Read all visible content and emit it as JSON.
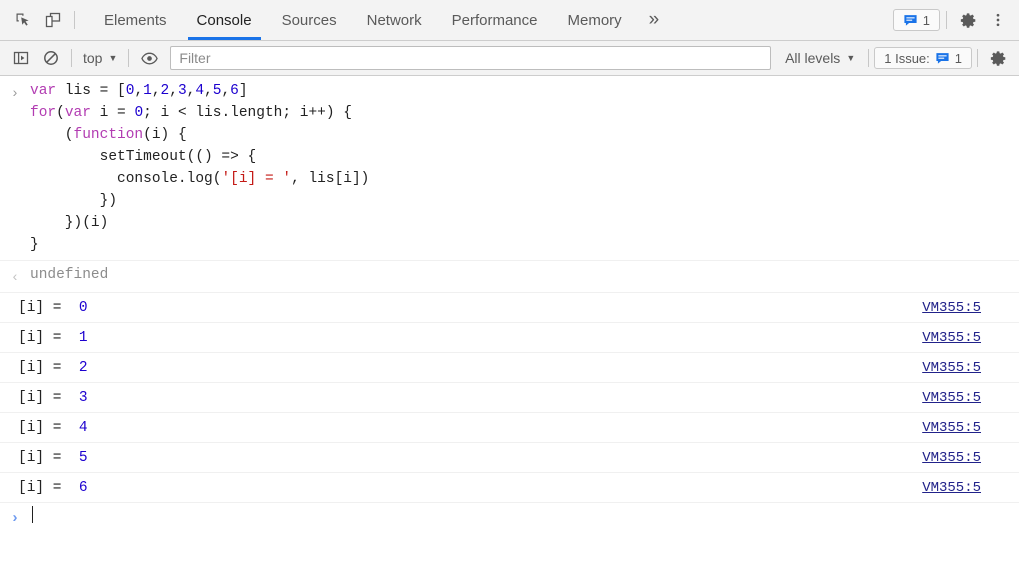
{
  "tabbar": {
    "inspect_icon": "inspect-element-icon",
    "device_icon": "device-toolbar-icon",
    "tabs": [
      {
        "id": "elements",
        "label": "Elements",
        "active": false
      },
      {
        "id": "console",
        "label": "Console",
        "active": true
      },
      {
        "id": "sources",
        "label": "Sources",
        "active": false
      },
      {
        "id": "network",
        "label": "Network",
        "active": false
      },
      {
        "id": "performance",
        "label": "Performance",
        "active": false
      },
      {
        "id": "memory",
        "label": "Memory",
        "active": false
      }
    ],
    "more_tabs_glyph": "»",
    "issues_badge": {
      "icon": "issue-message-icon",
      "count": "1"
    },
    "settings_icon": "gear-icon",
    "more_options_icon": "kebab-menu-icon",
    "accent_color": "#1a73e8"
  },
  "toolbar": {
    "sidebar_icon": "console-sidebar-icon",
    "clear_icon": "clear-console-icon",
    "context_label": "top",
    "eye_icon": "live-expression-icon",
    "filter_placeholder": "Filter",
    "filter_value": "",
    "levels_label": "All levels",
    "issue_chip_label": "1 Issue:",
    "issue_chip_count": "1",
    "settings_icon": "gear-icon",
    "caret_glyph": "▼"
  },
  "console": {
    "input_prompt": "›",
    "input_lines": [
      [
        {
          "t": "var ",
          "c": "kw"
        },
        {
          "t": "lis = [",
          "c": ""
        },
        {
          "t": "0",
          "c": "num"
        },
        {
          "t": ",",
          "c": ""
        },
        {
          "t": "1",
          "c": "num"
        },
        {
          "t": ",",
          "c": ""
        },
        {
          "t": "2",
          "c": "num"
        },
        {
          "t": ",",
          "c": ""
        },
        {
          "t": "3",
          "c": "num"
        },
        {
          "t": ",",
          "c": ""
        },
        {
          "t": "4",
          "c": "num"
        },
        {
          "t": ",",
          "c": ""
        },
        {
          "t": "5",
          "c": "num"
        },
        {
          "t": ",",
          "c": ""
        },
        {
          "t": "6",
          "c": "num"
        },
        {
          "t": "]",
          "c": ""
        }
      ],
      [
        {
          "t": "for",
          "c": "kw"
        },
        {
          "t": "(",
          "c": ""
        },
        {
          "t": "var ",
          "c": "kw"
        },
        {
          "t": "i = ",
          "c": ""
        },
        {
          "t": "0",
          "c": "num"
        },
        {
          "t": "; i < lis.length; i++) {",
          "c": ""
        }
      ],
      [
        {
          "t": "    (",
          "c": ""
        },
        {
          "t": "function",
          "c": "kw"
        },
        {
          "t": "(i) {",
          "c": ""
        }
      ],
      [
        {
          "t": "        setTimeout(() => {",
          "c": ""
        }
      ],
      [
        {
          "t": "          console.log(",
          "c": ""
        },
        {
          "t": "'[i] = '",
          "c": "str"
        },
        {
          "t": ", lis[i])",
          "c": ""
        }
      ],
      [
        {
          "t": "        })",
          "c": ""
        }
      ],
      [
        {
          "t": "    })(i)",
          "c": ""
        }
      ],
      [
        {
          "t": "}",
          "c": ""
        }
      ]
    ],
    "result_prompt": "‹",
    "result_value": "undefined",
    "log_label": "[i] =  ",
    "logs": [
      {
        "label": "[i] =  ",
        "value": "0",
        "source": "VM355:5"
      },
      {
        "label": "[i] =  ",
        "value": "1",
        "source": "VM355:5"
      },
      {
        "label": "[i] =  ",
        "value": "2",
        "source": "VM355:5"
      },
      {
        "label": "[i] =  ",
        "value": "3",
        "source": "VM355:5"
      },
      {
        "label": "[i] =  ",
        "value": "4",
        "source": "VM355:5"
      },
      {
        "label": "[i] =  ",
        "value": "5",
        "source": "VM355:5"
      },
      {
        "label": "[i] =  ",
        "value": "6",
        "source": "VM355:5"
      }
    ],
    "prompt_glyph": "›",
    "prompt_value": ""
  }
}
